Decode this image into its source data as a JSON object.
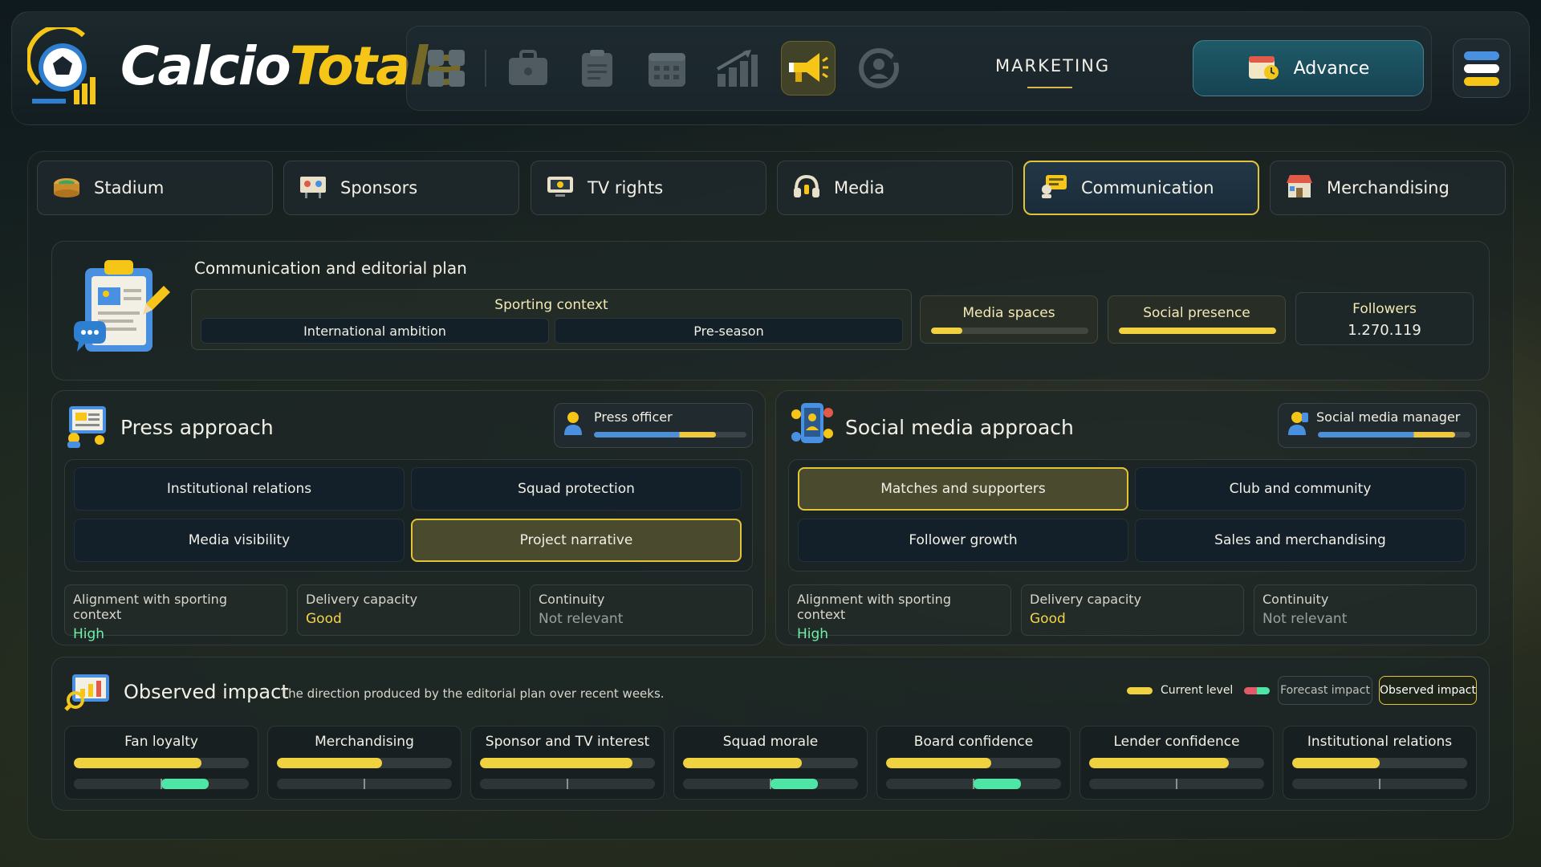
{
  "brand": {
    "name_part1": "Calcio",
    "name_part2": "Totale"
  },
  "header": {
    "section_title": "MARKETING",
    "advance_label": "Advance",
    "nav_icons": [
      "dashboard-icon",
      "briefcase-icon",
      "clipboard-icon",
      "calendar-icon",
      "growth-chart-icon",
      "megaphone-icon",
      "refresh-user-icon"
    ],
    "active_nav": "megaphone-icon"
  },
  "tabs": [
    {
      "label": "Stadium",
      "icon": "stadium-icon"
    },
    {
      "label": "Sponsors",
      "icon": "sponsors-icon"
    },
    {
      "label": "TV rights",
      "icon": "tv-icon"
    },
    {
      "label": "Media",
      "icon": "headphones-icon"
    },
    {
      "label": "Communication",
      "icon": "communication-icon",
      "active": true
    },
    {
      "label": "Merchandising",
      "icon": "shop-icon"
    }
  ],
  "plan": {
    "title": "Communication and editorial plan",
    "sporting_context_label": "Sporting context",
    "sporting_context": [
      "International ambition",
      "Pre-season"
    ],
    "media_spaces_label": "Media spaces",
    "media_spaces_level": 0.2,
    "social_presence_label": "Social presence",
    "social_presence_level": 1.0,
    "followers_label": "Followers",
    "followers_value": "1.270.119"
  },
  "press": {
    "title": "Press approach",
    "role_label": "Press officer",
    "role_level": 0.8,
    "options": [
      "Institutional relations",
      "Squad protection",
      "Media visibility",
      "Project narrative"
    ],
    "selected_index": 3,
    "metrics": [
      {
        "label": "Alignment with sporting context",
        "value": "High",
        "tone": "high"
      },
      {
        "label": "Delivery capacity",
        "value": "Good",
        "tone": "good"
      },
      {
        "label": "Continuity",
        "value": "Not relevant",
        "tone": "none"
      }
    ]
  },
  "social": {
    "title": "Social media approach",
    "role_label": "Social media manager",
    "role_level": 0.9,
    "options": [
      "Matches and supporters",
      "Club and community",
      "Follower growth",
      "Sales and merchandising"
    ],
    "selected_index": 0,
    "metrics": [
      {
        "label": "Alignment with sporting context",
        "value": "High",
        "tone": "high"
      },
      {
        "label": "Delivery capacity",
        "value": "Good",
        "tone": "good"
      },
      {
        "label": "Continuity",
        "value": "Not relevant",
        "tone": "none"
      }
    ]
  },
  "impact": {
    "title": "Observed impact",
    "subtitle": "The direction produced by the editorial plan over recent weeks.",
    "legend_current": "Current level",
    "legend_forecast": "Forecast impact",
    "legend_observed": "Observed impact",
    "items": [
      {
        "label": "Fan loyalty",
        "level": 0.73,
        "delta": 0.27
      },
      {
        "label": "Merchandising",
        "level": 0.6,
        "delta": 0
      },
      {
        "label": "Sponsor and TV interest",
        "level": 0.87,
        "delta": 0
      },
      {
        "label": "Squad morale",
        "level": 0.68,
        "delta": 0.27
      },
      {
        "label": "Board confidence",
        "level": 0.6,
        "delta": 0.27
      },
      {
        "label": "Lender confidence",
        "level": 0.8,
        "delta": 0
      },
      {
        "label": "Institutional relations",
        "level": 0.5,
        "delta": 0
      }
    ]
  },
  "colors": {
    "accent": "#f5c518",
    "positive": "#4ee6a4",
    "high": "#6ef0a8",
    "good": "#f2d44a"
  }
}
